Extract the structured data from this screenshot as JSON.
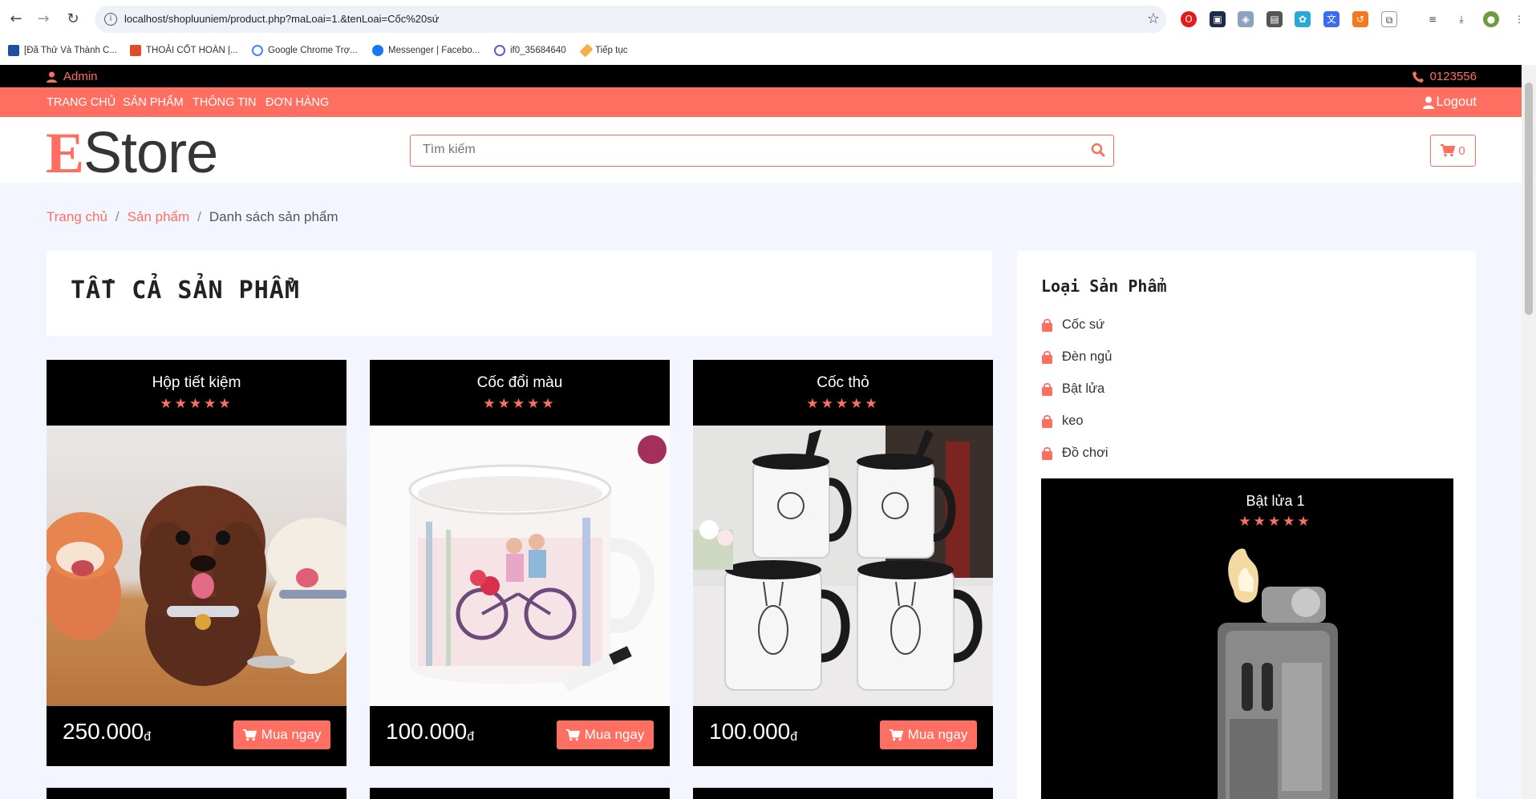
{
  "browser": {
    "url": "localhost/shopluuniem/product.php?maLoai=1.&tenLoai=Cốc%20sứ",
    "bookmarks": [
      "[Đã Thử Và Thành C...",
      "THOẢI CỐT HOÀN |...",
      "Google Chrome Trợ...",
      "Messenger | Facebo...",
      "if0_35684640",
      "Tiếp tục"
    ]
  },
  "topbar": {
    "user": "Admin",
    "phone": "0123556"
  },
  "menu": {
    "items": [
      "TRANG CHỦ",
      "SẢN PHẨM",
      "THÔNG TIN",
      "ĐƠN HÀNG"
    ],
    "logout": "Logout"
  },
  "header": {
    "logo_first": "E",
    "logo_rest": "Store",
    "search_placeholder": "Tìm kiếm",
    "cart_count": "0"
  },
  "breadcrumb": {
    "home": "Trang chủ",
    "products": "Sản phẩm",
    "current": "Danh sách sản phẩm",
    "sep": "/"
  },
  "main": {
    "title": "TẤT CẢ SẢN PHẨM",
    "products": [
      {
        "name": "Hộp tiết kiệm",
        "stars": "★★★★★",
        "price": "250.000",
        "currency": "đ",
        "buy": "Mua ngay"
      },
      {
        "name": "Cốc đổi màu",
        "stars": "★★★★★",
        "price": "100.000",
        "currency": "đ",
        "buy": "Mua ngay"
      },
      {
        "name": "Cốc thỏ",
        "stars": "★★★★★",
        "price": "100.000",
        "currency": "đ",
        "buy": "Mua ngay"
      }
    ]
  },
  "sidebar": {
    "title": "Loại Sản Phẩm",
    "categories": [
      "Cốc sứ",
      "Đèn ngủ",
      "Bật lửa",
      "keo",
      "Đồ chơi"
    ],
    "feature": {
      "name": "Bật lửa 1",
      "stars": "★★★★★"
    }
  },
  "colors": {
    "accent": "#ff6f61",
    "dark": "#000000",
    "page_bg": "#f3f6ff"
  }
}
